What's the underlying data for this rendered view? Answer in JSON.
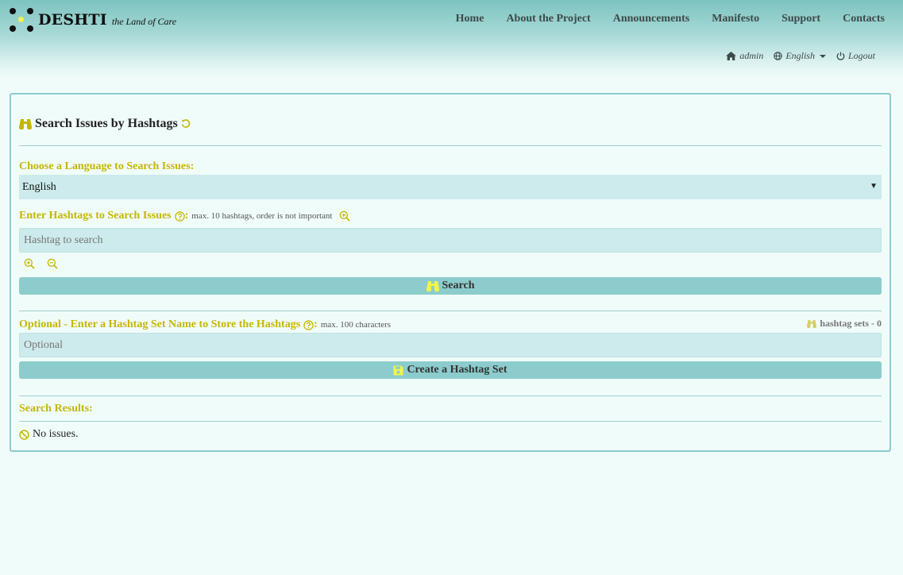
{
  "brand": {
    "name": "DESHTI",
    "tagline": "the Land of Care"
  },
  "nav": [
    "Home",
    "About the Project",
    "Announcements",
    "Manifesto",
    "Support",
    "Contacts"
  ],
  "user_nav": {
    "user": "admin",
    "language": "English",
    "logout": "Logout"
  },
  "panel": {
    "title": "Search Issues by Hashtags",
    "language_label": "Choose a Language to Search Issues:",
    "language_value": "English",
    "hashtags_label": "Enter Hashtags to Search Issues",
    "hashtags_colon": ":",
    "hashtags_hint": "max. 10 hashtags, order is not important",
    "hashtag_placeholder": "Hashtag to search",
    "search_button": "Search",
    "setname_label": "Optional - Enter a Hashtag Set Name to Store the Hashtags",
    "setname_colon": ":",
    "setname_hint": "max. 100 characters",
    "hashtag_sets": "hashtag sets - 0",
    "setname_placeholder": "Optional",
    "create_button": "Create a Hashtag Set",
    "results_label": "Search Results:",
    "no_issues": "No issues."
  },
  "colors": {
    "accent": "#c5b600",
    "panel_border": "#8ccccc",
    "button": "#8ccccc",
    "input_bg": "#cdebec"
  },
  "icons": [
    "binoculars-icon",
    "reset-icon",
    "help-icon",
    "zoom-in-icon",
    "zoom-out-icon",
    "save-icon",
    "ban-icon",
    "home-icon",
    "globe-icon",
    "power-icon"
  ]
}
